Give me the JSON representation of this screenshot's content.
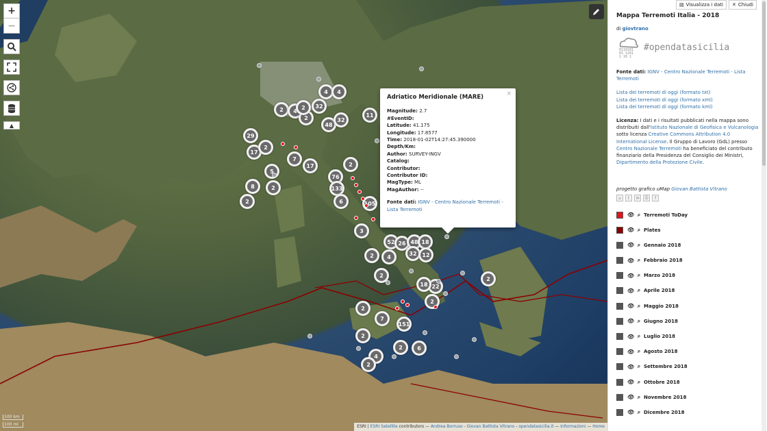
{
  "map": {
    "zoom_in": "+",
    "zoom_out": "−",
    "scale_km": "100 km",
    "scale_mi": "100 mi",
    "attribution": {
      "esri": "ESRI",
      "esri_link": "ESRI Satellite",
      "contributors": "contributors —",
      "andrea": "Andrea Borruso",
      "giovan": "Giovan Battista Vitrano",
      "site": "opendatasicilia.it",
      "info": "Informazioni",
      "home": "Home"
    },
    "clusters": [
      "4",
      "4",
      "32",
      "2",
      "4",
      "2",
      "48",
      "2",
      "32",
      "11",
      "29",
      "17",
      "2",
      "5",
      "7",
      "17",
      "76",
      "133",
      "6",
      "2",
      "8",
      "2",
      "2",
      "105",
      "3",
      "52",
      "26",
      "48",
      "18",
      "32",
      "12",
      "4",
      "2",
      "22",
      "18",
      "2",
      "2",
      "7",
      "2",
      "151",
      "4",
      "2",
      "6",
      "2",
      "2",
      "2"
    ],
    "colors": {
      "cluster": "#6a6a6a",
      "quake": "#e0161f",
      "plate": "#8b0000"
    }
  },
  "popup": {
    "title": "Adriatico Meridionale (MARE)",
    "close": "×",
    "rows": [
      {
        "label": "Magnitude:",
        "value": " 2.7"
      },
      {
        "label": "#EventID:",
        "value": ""
      },
      {
        "label": "Latitude:",
        "value": " 41.175"
      },
      {
        "label": "Longitude:",
        "value": " 17.8577"
      },
      {
        "label": "Time:",
        "value": " 2018-01-02T14:27:45.390000"
      },
      {
        "label": "Depth/Km:",
        "value": ""
      },
      {
        "label": "Author:",
        "value": " SURVEY-INGV"
      },
      {
        "label": "Catalog:",
        "value": ""
      },
      {
        "label": "Contributor:",
        "value": ""
      },
      {
        "label": "Contributor ID:",
        "value": ""
      },
      {
        "label": "MagType:",
        "value": " ML"
      },
      {
        "label": "MagAuthor:",
        "value": " --"
      }
    ],
    "source_label": "Fonte dati:",
    "source_link": "IGNV - Centro Nazionale Terremoti - Lista Terremoti"
  },
  "top_buttons": {
    "view_data": "Visualizza i dati",
    "close": "Chiudi"
  },
  "panel": {
    "title": "Mappa Terremoti Italia - 2018",
    "by_prefix": "di",
    "author": "giovtrano",
    "logo_text": "#opendatasicilia",
    "source_label": "Fonte dati:",
    "source_link": "IGNV - Centro Nazionale Terremoti - Lista Terremoti",
    "links": [
      "Lista dei terremoti di oggi (formato txt)",
      "Lista dei terremoti di oggi (formato xml)",
      "Lista dei terremoti di oggi (formato kml)"
    ],
    "license": {
      "label": "Licenza:",
      "t1": " I dati e i risultati pubblicati nella mappa sono distribuiti dall'",
      "l1": "Istituto Nazionale di Geofisica e Vulcanologia",
      "t2": " sotto licenza ",
      "l2": "Creative Commons Attribution 4.0 International License",
      "t3": ". Il Gruppo di Lavoro (GdL) presso ",
      "l3": "Centro Nazionale Terremoti",
      "t4": " ha beneficiato del contributo finanziario della Presidenza del Consiglio dei Ministri, ",
      "l4": "Dipartimento della Protezione Civile",
      "t5": "."
    },
    "credit_prefix": "progetto grafico uMap",
    "credit_name": "Giovan Battista Vitrano",
    "layers": [
      {
        "name": "Terremoti ToDay",
        "color": "#e0161f"
      },
      {
        "name": "Plates",
        "color": "#8b0000"
      },
      {
        "name": "Gennaio 2018",
        "color": "#555555"
      },
      {
        "name": "Febbraio 2018",
        "color": "#555555"
      },
      {
        "name": "Marzo 2018",
        "color": "#555555"
      },
      {
        "name": "Aprile 2018",
        "color": "#555555"
      },
      {
        "name": "Maggio 2018",
        "color": "#555555"
      },
      {
        "name": "Giugno 2018",
        "color": "#555555"
      },
      {
        "name": "Luglio 2018",
        "color": "#555555"
      },
      {
        "name": "Agosto 2018",
        "color": "#555555"
      },
      {
        "name": "Settembre 2018",
        "color": "#555555"
      },
      {
        "name": "Ottobre 2018",
        "color": "#555555"
      },
      {
        "name": "Novembre 2018",
        "color": "#555555"
      },
      {
        "name": "Dicembre 2018",
        "color": "#555555"
      }
    ]
  }
}
